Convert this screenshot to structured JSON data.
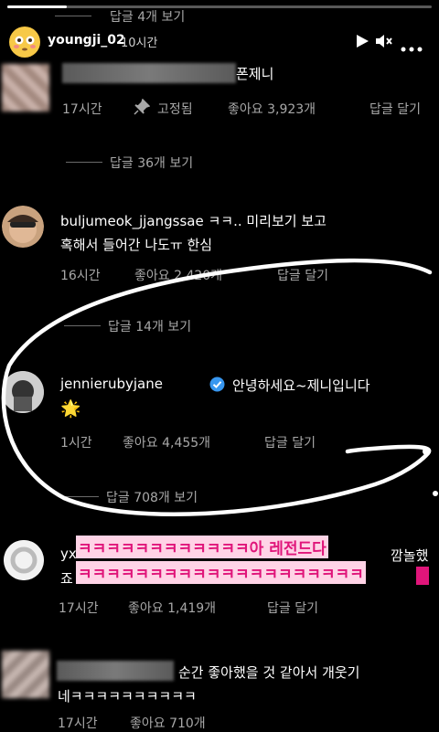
{
  "story": {
    "progress": 0.14,
    "top_peek": "답글 4개 보기",
    "username": "youngji_02",
    "time": "10시간"
  },
  "comments": [
    {
      "user_text": "폰제니",
      "time": "17시간",
      "pinned": "고정됨",
      "likes": "좋아요 3,923개",
      "reply": "답글 달기",
      "view_replies": "답글 36개 보기"
    },
    {
      "username": "buljumeok_jjangssae",
      "text1": "ㅋㅋ.. 미리보기 보고",
      "text2": "혹해서 들어간 나도ㅠ 한심",
      "time": "16시간",
      "likes": "좋아요 2,420개",
      "reply": "답글 달기",
      "view_replies": "답글 14개 보기"
    },
    {
      "username": "jennierubyjane",
      "text1": "안녕하세요~제니입니다",
      "text2": "🌟",
      "time": "1시간",
      "likes": "좋아요 4,455개",
      "reply": "답글 달기",
      "view_replies": "답글 708개 보기"
    },
    {
      "username_partial": "yx",
      "text_end": "깜놀했",
      "text2_start": "죠",
      "time": "17시간",
      "likes": "좋아요 1,419개",
      "reply": "답글 달기"
    },
    {
      "text1": "순간 좋아했을 것 같아서 개웃기",
      "text2": "네ㅋㅋㅋㅋㅋㅋㅋㅋㅋㅋ",
      "time": "17시간",
      "likes": "좋아요 710개"
    }
  ],
  "overlay": {
    "line1": "ㅋㅋㅋㅋㅋㅋㅋㅋㅋㅋㅋㅋ아 레전드다",
    "line2": "ㅋㅋㅋㅋㅋㅋㅋㅋㅋㅋㅋㅋㅋㅋㅋㅋㅋㅋㅋㅋ",
    "text_color": "#e0157a",
    "bg_color": "#ffd3e6"
  },
  "colors": {
    "background": "#000000",
    "secondary_text": "#a8a8a8",
    "verified": "#3897f0"
  },
  "icons": [
    "play-icon",
    "mute-icon",
    "more-icon",
    "pin-icon",
    "verified-icon"
  ]
}
